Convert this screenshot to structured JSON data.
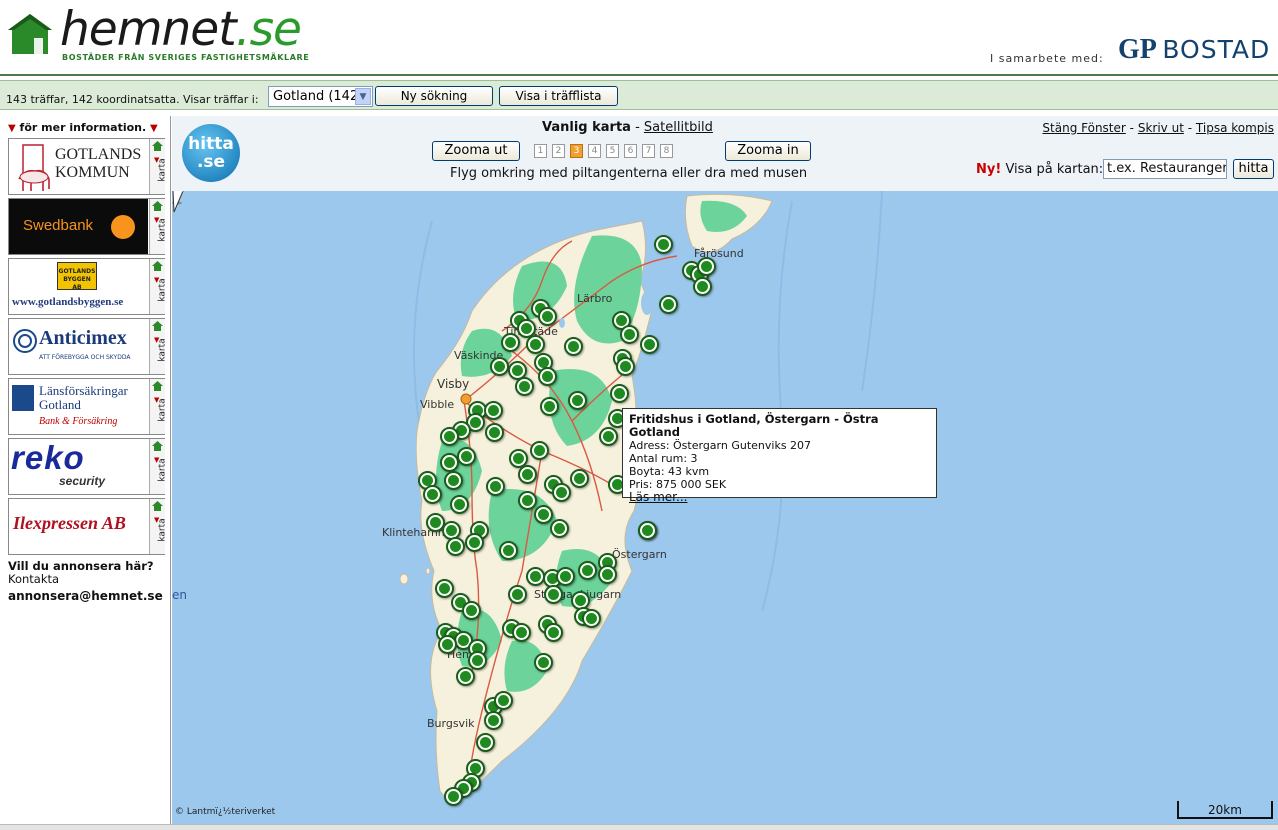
{
  "header": {
    "logo_main": "hemnet",
    "logo_tld": ".se",
    "logo_tagline": "BOSTÄDER FRÅN SVERIGES FASTIGHETSMÄKLARE",
    "partner_label": "I samarbete med:",
    "partner_logo_gp": "GP",
    "partner_logo_bostad": "BOSTAD"
  },
  "toolbar": {
    "hits_text": "143 träffar, 142 koordinatsatta. Visar träffar i:",
    "area_select_value": "Gotland (142)",
    "new_search_label": "Ny sökning",
    "show_list_label": "Visa i träfflista"
  },
  "sidebar": {
    "heading": "för mer information.",
    "ads": [
      {
        "name": "GOTLANDS KOMMUN",
        "line1": "GOTLANDS",
        "line2": "KOMMUN",
        "side_label": "karta"
      },
      {
        "name": "Swedbank",
        "line1": "Swedbank",
        "side_label": "karta"
      },
      {
        "name": "Gotlandsbyggen",
        "line1": "GOTLANDS BYGGEN AB",
        "line2": "www.gotlandsbyggen.se",
        "side_label": "karta"
      },
      {
        "name": "Anticimex",
        "line1": "Anticimex",
        "line2": "ATT FÖREBYGGA OCH SKYDDA",
        "side_label": "karta"
      },
      {
        "name": "Länsförsäkringar Gotland",
        "line1": "Länsförsäkringar",
        "line2": "Gotland",
        "line3": "Bank & Försäkring",
        "side_label": "karta"
      },
      {
        "name": "reko security",
        "line1": "reko",
        "line2": "security",
        "side_label": "karta"
      },
      {
        "name": "Ilexpressen AB",
        "line1": "Ilexpressen AB",
        "side_label": "karta"
      }
    ],
    "cta": "Vill du annonsera här?",
    "contact": "Kontakta",
    "email": "annonsera@hemnet.se"
  },
  "map_panel": {
    "logo_line1": "hitta",
    "logo_line2": ".se",
    "map_type_active": "Vanlig karta",
    "map_type_separator": "-",
    "map_type_other": "Satellitbild",
    "zoom_out_label": "Zooma ut",
    "zoom_in_label": "Zooma in",
    "zoom_levels": [
      "1",
      "2",
      "3",
      "4",
      "5",
      "6",
      "7",
      "8"
    ],
    "zoom_active": "3",
    "hint": "Flyg omkring med piltangenterna eller dra med musen",
    "link_close": "Stäng Fönster",
    "link_print": "Skriv ut",
    "link_tip": "Tipsa kompis",
    "link_separator": "-",
    "new_label": "Ny!",
    "show_on_map_label": "Visa på kartan:",
    "poi_placeholder": "t.ex. Restauranger",
    "hitta_button": "hitta"
  },
  "map": {
    "places": [
      "Fårösund",
      "Lärbro",
      "Tingstäde",
      "Väskinde",
      "Visby",
      "Vibble",
      "Klintehamn",
      "Östergarn",
      "Stånga",
      "Ljugarn",
      "Hemse",
      "Burgsvik"
    ],
    "popup": {
      "title": "Fritidshus i Gotland, Östergarn - Östra Gotland",
      "address": "Adress: Östergarn Gutenviks 207",
      "rooms": "Antal rum: 3",
      "area": "Boyta: 43 kvm",
      "price": "Pris: 875 000 SEK",
      "more": "Läs mer..."
    },
    "copyright": "© Lantmï¿½teriverket",
    "scale_label": "20km",
    "edge_label": "en"
  },
  "colors": {
    "sea": "#9cc8ee",
    "land": "#f6f1dc",
    "forest": "#6cd49a",
    "road": "#d95a44",
    "marker": "#1f8a1f"
  }
}
